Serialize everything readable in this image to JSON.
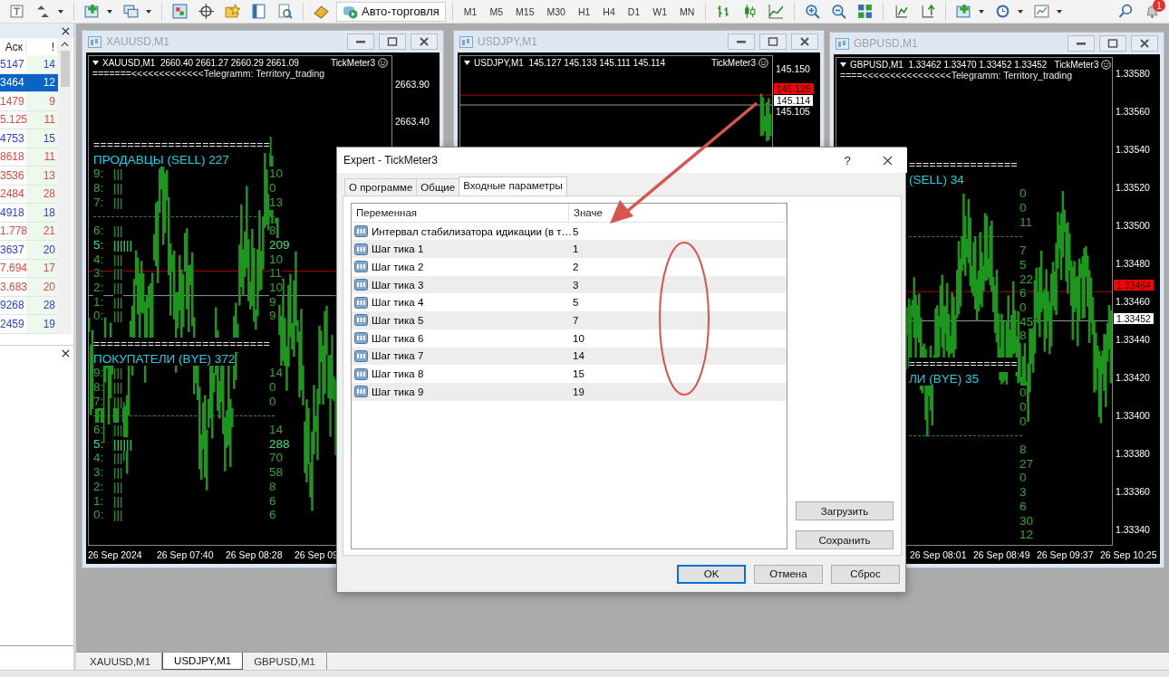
{
  "toolbar": {
    "auto_trading": "Авто-торговля",
    "timeframes": [
      "M1",
      "M5",
      "M15",
      "M30",
      "H1",
      "H4",
      "D1",
      "W1",
      "MN"
    ],
    "notifications": "1"
  },
  "market_watch": {
    "columns": [
      "Аск",
      "!"
    ],
    "rows": [
      {
        "ask": "5147",
        "spread": "14",
        "color": "#2b3fd9",
        "selected": false
      },
      {
        "ask": "3464",
        "spread": "12",
        "selected": true
      },
      {
        "ask": "1479",
        "spread": "9",
        "color": "#e8453c",
        "selected": false
      },
      {
        "ask": "5.125",
        "spread": "11",
        "color": "#e8453c",
        "selected": false
      },
      {
        "ask": "4753",
        "spread": "15",
        "color": "#2b3fd9",
        "selected": false
      },
      {
        "ask": "8618",
        "spread": "11",
        "color": "#e8453c",
        "selected": false
      },
      {
        "ask": "3536",
        "spread": "13",
        "color": "#e8453c",
        "selected": false
      },
      {
        "ask": "2484",
        "spread": "28",
        "color": "#e8453c",
        "selected": false
      },
      {
        "ask": "4918",
        "spread": "18",
        "color": "#2b3fd9",
        "selected": false
      },
      {
        "ask": "1.778",
        "spread": "21",
        "color": "#e8453c",
        "selected": false
      },
      {
        "ask": "3637",
        "spread": "20",
        "color": "#2b3fd9",
        "selected": false
      },
      {
        "ask": "7.694",
        "spread": "17",
        "color": "#e8453c",
        "selected": false
      },
      {
        "ask": "3.683",
        "spread": "20",
        "color": "#e8453c",
        "selected": false
      },
      {
        "ask": "9268",
        "spread": "28",
        "color": "#2b3fd9",
        "selected": false
      },
      {
        "ask": "2459",
        "spread": "19",
        "color": "#2b3fd9",
        "selected": false
      }
    ]
  },
  "charts": [
    {
      "title": "XAUUSD,M1",
      "header": "XAUUSD,M1  2660.40 2661.27 2660.29 2661.09",
      "indicator": "TickMeter3",
      "banner": "=======<<<<<<<<<<<<<Telegramm: Territory_trading",
      "price_ticks": [
        "2663.90",
        "2663.40"
      ],
      "time_labels": [
        "26 Sep 2024",
        "26 Sep 07:40",
        "26 Sep 08:28",
        "26 Sep 09"
      ],
      "panels": [
        {
          "separator": "==========================",
          "title": "ПРОДАВЦЫ (SELL) 227",
          "rows": [
            {
              "label": "9:",
              "bars": "|||",
              "count": "10",
              "highlight": false
            },
            {
              "label": "8:",
              "bars": "|||",
              "count": "0",
              "highlight": false
            },
            {
              "label": "7:",
              "bars": "|||",
              "count": "13",
              "highlight": false
            },
            {
              "label": "6:",
              "bars": "|||",
              "count": "8",
              "highlight": false
            },
            {
              "label": "5:",
              "bars": "||||||",
              "count": "209",
              "highlight": true
            },
            {
              "label": "4:",
              "bars": "|||",
              "count": "10",
              "highlight": false
            },
            {
              "label": "3:",
              "bars": "|||",
              "count": "11",
              "highlight": false
            },
            {
              "label": "2:",
              "bars": "|||",
              "count": "10",
              "highlight": false
            },
            {
              "label": "1:",
              "bars": "|||",
              "count": "9",
              "highlight": false
            },
            {
              "label": "0:",
              "bars": "|||",
              "count": "9",
              "highlight": false
            }
          ]
        },
        {
          "separator": "==========================",
          "title": "ПОКУПАТЕЛИ (BYE) 372",
          "rows": [
            {
              "label": "9:",
              "bars": "|||",
              "count": "14",
              "highlight": false
            },
            {
              "label": "8:",
              "bars": "|||",
              "count": "0",
              "highlight": false
            },
            {
              "label": "7:",
              "bars": "|||",
              "count": "0",
              "highlight": false
            },
            {
              "label": "6:",
              "bars": "|||",
              "count": "14",
              "highlight": false
            },
            {
              "label": "5:",
              "bars": "||||||",
              "count": "288",
              "highlight": true
            },
            {
              "label": "4:",
              "bars": "|||",
              "count": "70",
              "highlight": false
            },
            {
              "label": "3:",
              "bars": "|||",
              "count": "58",
              "highlight": false
            },
            {
              "label": "2:",
              "bars": "|||",
              "count": "8",
              "highlight": false
            },
            {
              "label": "1:",
              "bars": "|||",
              "count": "6",
              "highlight": false
            },
            {
              "label": "0:",
              "bars": "|||",
              "count": "6",
              "highlight": false
            }
          ]
        }
      ]
    },
    {
      "title": "USDJPY,M1",
      "header": "USDJPY,M1  145.127 145.133 145.111 145.114",
      "indicator": "TickMeter3",
      "price_ticks": [
        "145.150",
        "145.105"
      ],
      "ask_label": "145.125",
      "bid_label": "145.114"
    },
    {
      "title": "GBPUSD,M1",
      "header": "GBPUSD,M1  1.33462 1.33470 1.33452 1.33452",
      "indicator": "TickMeter3",
      "banner": "====<<<<<<<<<<<<<<<<Telegramm: Territory_trading",
      "price_ticks": [
        "1.33580",
        "1.33560",
        "1.33540",
        "1.33520",
        "1.33500",
        "1.33480",
        "1.33460",
        "1.33440",
        "1.33420",
        "1.33400",
        "1.33380",
        "1.33360",
        "1.33340"
      ],
      "ask_label": "1.33464",
      "bid_label": "1.33452",
      "time_labels": [
        "26 Sep 08:01",
        "26 Sep 08:49",
        "26 Sep 09:37",
        "26 Sep 10:25"
      ],
      "panels": [
        {
          "separator": "================",
          "title": "(SELL) 34",
          "rows": [
            {
              "count": "0",
              "highlight": false
            },
            {
              "count": "0",
              "highlight": false
            },
            {
              "count": "11",
              "highlight": false
            },
            {
              "count": "7",
              "highlight": false
            },
            {
              "count": "5",
              "highlight": false
            },
            {
              "count": "22",
              "highlight": false
            },
            {
              "count": "6",
              "highlight": false
            },
            {
              "count": "0",
              "highlight": false
            },
            {
              "count": "45",
              "highlight": false
            },
            {
              "count": "8",
              "highlight": false
            }
          ]
        },
        {
          "separator": "================",
          "title": "ЛИ (BYE) 35",
          "rows": [
            {
              "count": "0",
              "highlight": false
            },
            {
              "count": "0",
              "highlight": false
            },
            {
              "count": "0",
              "highlight": false
            },
            {
              "count": "8",
              "highlight": false
            },
            {
              "count": "27",
              "highlight": false
            },
            {
              "count": "0",
              "highlight": false
            },
            {
              "count": "3",
              "highlight": false
            },
            {
              "count": "6",
              "highlight": false
            },
            {
              "count": "30",
              "highlight": false
            },
            {
              "count": "12",
              "highlight": false
            }
          ]
        }
      ]
    }
  ],
  "dialog": {
    "title": "Expert - TickMeter3",
    "help": "?",
    "tabs": [
      {
        "label": "О программе",
        "selected": false
      },
      {
        "label": "Общие",
        "selected": false
      },
      {
        "label": "Входные параметры",
        "selected": true
      }
    ],
    "columns": [
      "Переменная",
      "Значе"
    ],
    "params": [
      {
        "name": "Интервал стабилизатора идикации (в т…",
        "value": "5"
      },
      {
        "name": "Шаг тика 1",
        "value": "1"
      },
      {
        "name": "Шаг тика 2",
        "value": "2"
      },
      {
        "name": "Шаг тика 3",
        "value": "3"
      },
      {
        "name": "Шаг тика 4",
        "value": "5"
      },
      {
        "name": "Шаг тика 5",
        "value": "7"
      },
      {
        "name": "Шаг тика 6",
        "value": "10"
      },
      {
        "name": "Шаг тика 7",
        "value": "14"
      },
      {
        "name": "Шаг тика 8",
        "value": "15"
      },
      {
        "name": "Шаг тика 9",
        "value": "19"
      }
    ],
    "side_buttons": [
      "Загрузить",
      "Сохранить"
    ],
    "buttons": [
      {
        "label": "OK",
        "focused": true
      },
      {
        "label": "Отмена",
        "focused": false
      },
      {
        "label": "Сброс",
        "focused": false
      }
    ]
  },
  "chart_tabs": [
    {
      "label": "XAUUSD,M1",
      "selected": false
    },
    {
      "label": "USDJPY,M1",
      "selected": true
    },
    {
      "label": "GBPUSD,M1",
      "selected": false
    }
  ]
}
